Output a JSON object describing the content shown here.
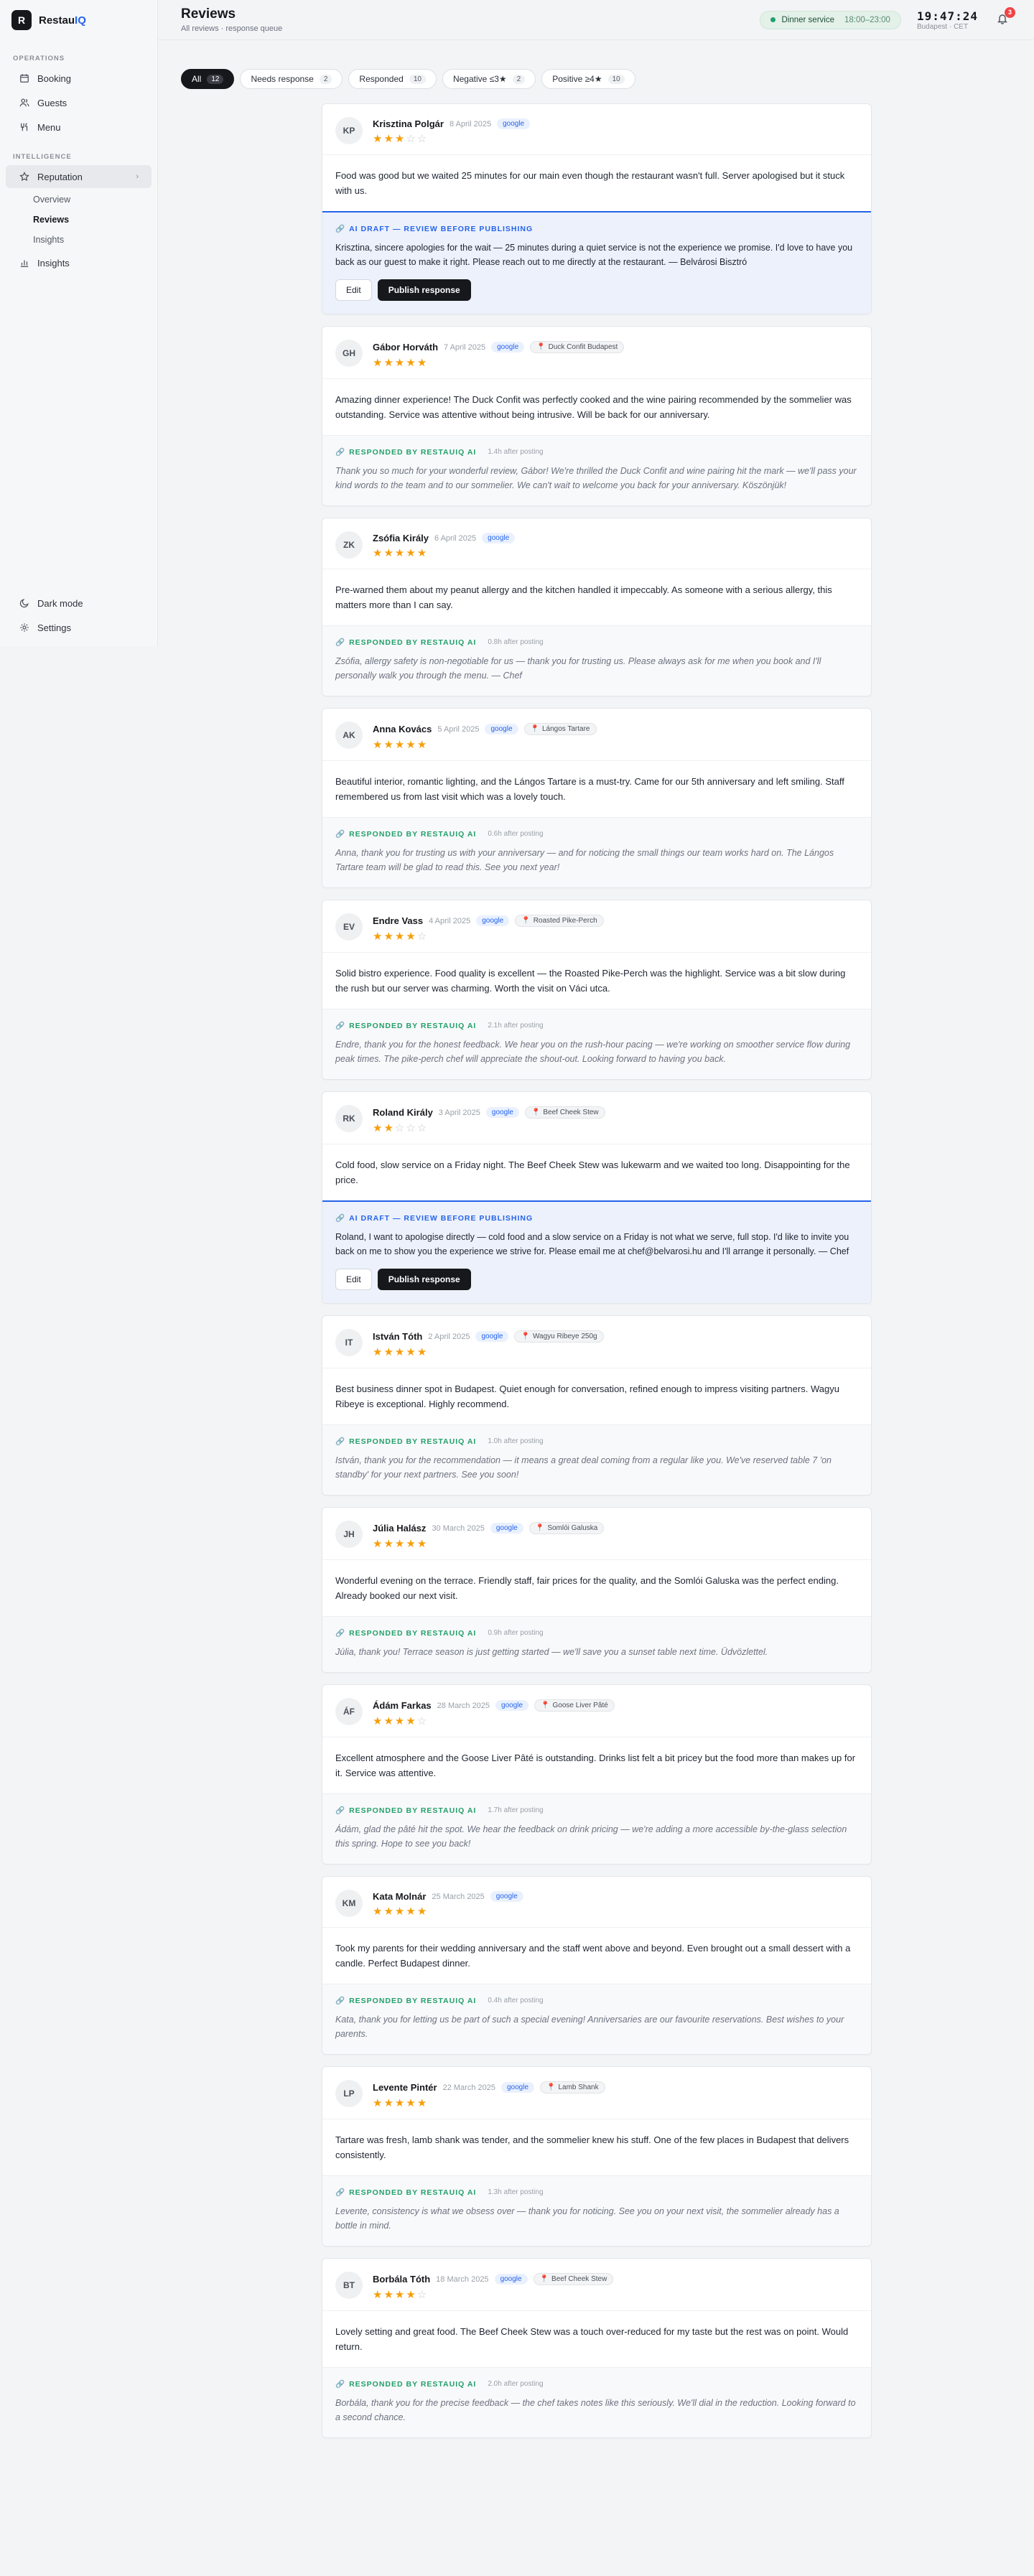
{
  "brand": {
    "logo_letter": "R",
    "name_a": "Restau",
    "name_b": "IQ"
  },
  "sidebar": {
    "sections": [
      {
        "title": "Operations"
      },
      {
        "title": "Intelligence"
      }
    ],
    "items": {
      "booking": "Booking",
      "guests": "Guests",
      "menu": "Menu",
      "reputation": "Reputation",
      "insights": "Insights",
      "dark_mode": "Dark mode",
      "settings": "Settings"
    },
    "subitems": [
      "Overview",
      "Reviews",
      "Insights"
    ]
  },
  "header": {
    "title": "Reviews",
    "subtitle": "All reviews · response queue",
    "service_label": "Dinner service",
    "service_hours": "18:00–23:00",
    "clock_time": "19:47:24",
    "clock_tz": "Budapest · CET",
    "notif_count": "3"
  },
  "filters": [
    {
      "label": "All",
      "count": "12",
      "active": true
    },
    {
      "label": "Needs response",
      "count": "2"
    },
    {
      "label": "Responded",
      "count": "10"
    },
    {
      "label": "Negative ≤3★",
      "count": "2"
    },
    {
      "label": "Positive ≥4★",
      "count": "10"
    }
  ],
  "labels": {
    "responded": "Responded by RestauIQ AI",
    "draft": "AI draft — review before publishing",
    "edit": "Edit",
    "publish": "Publish response"
  },
  "reviews": [
    {
      "initials": "KP",
      "author": "Krisztina Polgár",
      "date": "8 April 2025",
      "source": "google",
      "dish": "",
      "rating": 3,
      "text": "Food was good but we waited 25 minutes for our main even though the restaurant wasn't full. Server apologised but it stuck with us.",
      "status": "draft",
      "reply": "Krisztina, sincere apologies for the wait — 25 minutes during a quiet service is not the experience we promise. I'd love to have you back as our guest to make it right. Please reach out to me directly at the restaurant. — Belvárosi Bisztró"
    },
    {
      "initials": "GH",
      "author": "Gábor Horváth",
      "date": "7 April 2025",
      "source": "google",
      "dish": "Duck Confit Budapest",
      "rating": 5,
      "text": "Amazing dinner experience! The Duck Confit was perfectly cooked and the wine pairing recommended by the sommelier was outstanding. Service was attentive without being intrusive. Will be back for our anniversary.",
      "status": "responded",
      "reply_time": "1.4h after posting",
      "reply": "Thank you so much for your wonderful review, Gábor! We're thrilled the Duck Confit and wine pairing hit the mark — we'll pass your kind words to the team and to our sommelier. We can't wait to welcome you back for your anniversary. Köszönjük!"
    },
    {
      "initials": "ZK",
      "author": "Zsófia Király",
      "date": "6 April 2025",
      "source": "google",
      "dish": "",
      "rating": 5,
      "text": "Pre-warned them about my peanut allergy and the kitchen handled it impeccably. As someone with a serious allergy, this matters more than I can say.",
      "status": "responded",
      "reply_time": "0.8h after posting",
      "reply": "Zsófia, allergy safety is non-negotiable for us — thank you for trusting us. Please always ask for me when you book and I'll personally walk you through the menu. — Chef"
    },
    {
      "initials": "AK",
      "author": "Anna Kovács",
      "date": "5 April 2025",
      "source": "google",
      "dish": "Lángos Tartare",
      "rating": 5,
      "text": "Beautiful interior, romantic lighting, and the Lángos Tartare is a must-try. Came for our 5th anniversary and left smiling. Staff remembered us from last visit which was a lovely touch.",
      "status": "responded",
      "reply_time": "0.6h after posting",
      "reply": "Anna, thank you for trusting us with your anniversary — and for noticing the small things our team works hard on. The Lángos Tartare team will be glad to read this. See you next year!"
    },
    {
      "initials": "EV",
      "author": "Endre Vass",
      "date": "4 April 2025",
      "source": "google",
      "dish": "Roasted Pike-Perch",
      "rating": 4,
      "text": "Solid bistro experience. Food quality is excellent — the Roasted Pike-Perch was the highlight. Service was a bit slow during the rush but our server was charming. Worth the visit on Váci utca.",
      "status": "responded",
      "reply_time": "2.1h after posting",
      "reply": "Endre, thank you for the honest feedback. We hear you on the rush-hour pacing — we're working on smoother service flow during peak times. The pike-perch chef will appreciate the shout-out. Looking forward to having you back."
    },
    {
      "initials": "RK",
      "author": "Roland Király",
      "date": "3 April 2025",
      "source": "google",
      "dish": "Beef Cheek Stew",
      "rating": 2,
      "text": "Cold food, slow service on a Friday night. The Beef Cheek Stew was lukewarm and we waited too long. Disappointing for the price.",
      "status": "draft",
      "reply": "Roland, I want to apologise directly — cold food and a slow service on a Friday is not what we serve, full stop. I'd like to invite you back on me to show you the experience we strive for. Please email me at chef@belvarosi.hu and I'll arrange it personally. — Chef"
    },
    {
      "initials": "IT",
      "author": "István Tóth",
      "date": "2 April 2025",
      "source": "google",
      "dish": "Wagyu Ribeye 250g",
      "rating": 5,
      "text": "Best business dinner spot in Budapest. Quiet enough for conversation, refined enough to impress visiting partners. Wagyu Ribeye is exceptional. Highly recommend.",
      "status": "responded",
      "reply_time": "1.0h after posting",
      "reply": "István, thank you for the recommendation — it means a great deal coming from a regular like you. We've reserved table 7 'on standby' for your next partners. See you soon!"
    },
    {
      "initials": "JH",
      "author": "Júlia Halász",
      "date": "30 March 2025",
      "source": "google",
      "dish": "Somlói Galuska",
      "rating": 5,
      "text": "Wonderful evening on the terrace. Friendly staff, fair prices for the quality, and the Somlói Galuska was the perfect ending. Already booked our next visit.",
      "status": "responded",
      "reply_time": "0.9h after posting",
      "reply": "Júlia, thank you! Terrace season is just getting started — we'll save you a sunset table next time. Üdvözlettel."
    },
    {
      "initials": "ÁF",
      "author": "Ádám Farkas",
      "date": "28 March 2025",
      "source": "google",
      "dish": "Goose Liver Pâté",
      "rating": 4,
      "text": "Excellent atmosphere and the Goose Liver Pâté is outstanding. Drinks list felt a bit pricey but the food more than makes up for it. Service was attentive.",
      "status": "responded",
      "reply_time": "1.7h after posting",
      "reply": "Ádám, glad the pâté hit the spot. We hear the feedback on drink pricing — we're adding a more accessible by-the-glass selection this spring. Hope to see you back!"
    },
    {
      "initials": "KM",
      "author": "Kata Molnár",
      "date": "25 March 2025",
      "source": "google",
      "dish": "",
      "rating": 5,
      "text": "Took my parents for their wedding anniversary and the staff went above and beyond. Even brought out a small dessert with a candle. Perfect Budapest dinner.",
      "status": "responded",
      "reply_time": "0.4h after posting",
      "reply": "Kata, thank you for letting us be part of such a special evening! Anniversaries are our favourite reservations. Best wishes to your parents."
    },
    {
      "initials": "LP",
      "author": "Levente Pintér",
      "date": "22 March 2025",
      "source": "google",
      "dish": "Lamb Shank",
      "rating": 5,
      "text": "Tartare was fresh, lamb shank was tender, and the sommelier knew his stuff. One of the few places in Budapest that delivers consistently.",
      "status": "responded",
      "reply_time": "1.3h after posting",
      "reply": "Levente, consistency is what we obsess over — thank you for noticing. See you on your next visit, the sommelier already has a bottle in mind."
    },
    {
      "initials": "BT",
      "author": "Borbála Tóth",
      "date": "18 March 2025",
      "source": "google",
      "dish": "Beef Cheek Stew",
      "rating": 4,
      "text": "Lovely setting and great food. The Beef Cheek Stew was a touch over-reduced for my taste but the rest was on point. Would return.",
      "status": "responded",
      "reply_time": "2.0h after posting",
      "reply": "Borbála, thank you for the precise feedback — the chef takes notes like this seriously. We'll dial in the reduction. Looking forward to a second chance."
    }
  ]
}
